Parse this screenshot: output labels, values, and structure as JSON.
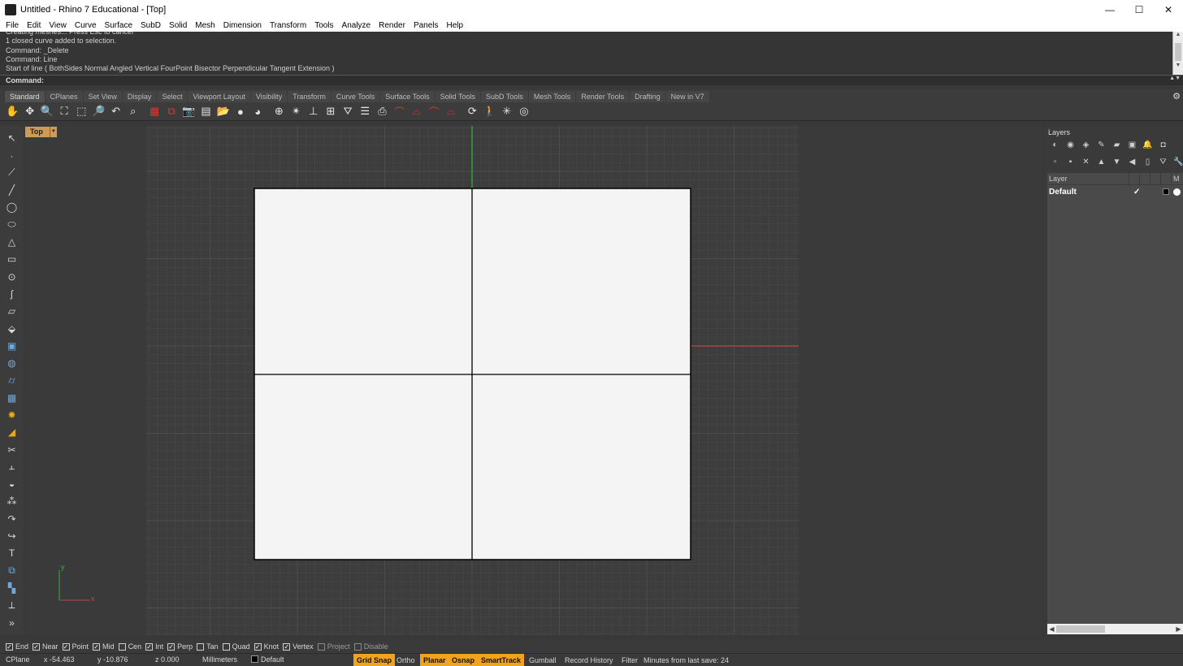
{
  "window": {
    "title": "Untitled - Rhino 7 Educational - [Top]",
    "controls": {
      "minimize": "—",
      "maximize": "☐",
      "close": "✕"
    }
  },
  "menu": [
    "File",
    "Edit",
    "View",
    "Curve",
    "Surface",
    "SubD",
    "Solid",
    "Mesh",
    "Dimension",
    "Transform",
    "Tools",
    "Analyze",
    "Render",
    "Panels",
    "Help"
  ],
  "command_history": [
    "Creating meshes... Press Esc to cancel",
    "1 closed curve added to selection.",
    "Command: _Delete",
    "Command: Line",
    "Start of line ( BothSides  Normal  Angled  Vertical  FourPoint  Bisector  Perpendicular  Tangent  Extension )"
  ],
  "command_line": {
    "label": "Command:",
    "value": ""
  },
  "toolbar_tabs": [
    "Standard",
    "CPlanes",
    "Set View",
    "Display",
    "Select",
    "Viewport Layout",
    "Visibility",
    "Transform",
    "Curve Tools",
    "Surface Tools",
    "Solid Tools",
    "SubD Tools",
    "Mesh Tools",
    "Render Tools",
    "Drafting",
    "New in V7"
  ],
  "active_tab": "Standard",
  "tool_icons": [
    {
      "name": "pan-icon",
      "glyph": "✋"
    },
    {
      "name": "rotate-view-icon",
      "glyph": "✥"
    },
    {
      "name": "zoom-dynamic-icon",
      "glyph": "🔍"
    },
    {
      "name": "zoom-extents-icon",
      "glyph": "⛶"
    },
    {
      "name": "zoom-window-icon",
      "glyph": "⬚"
    },
    {
      "name": "zoom-selected-icon",
      "glyph": "🔎"
    },
    {
      "name": "undo-view-icon",
      "glyph": "↶"
    },
    {
      "name": "zoom-target-icon",
      "glyph": "⌕"
    },
    {
      "name": "four-view-icon",
      "glyph": "▦"
    },
    {
      "name": "perspective-icon",
      "glyph": "⧉"
    },
    {
      "name": "camera-icon",
      "glyph": "📷"
    },
    {
      "name": "named-views-icon",
      "glyph": "▤"
    },
    {
      "name": "open-folder-icon",
      "glyph": "📂"
    },
    {
      "name": "sphere-shaded-icon",
      "glyph": "●"
    },
    {
      "name": "render-icon",
      "glyph": "◕"
    },
    {
      "name": "osnap-icon",
      "glyph": "⊕"
    },
    {
      "name": "smart-track-icon",
      "glyph": "✴"
    },
    {
      "name": "gumball-icon",
      "glyph": "⊥"
    },
    {
      "name": "cplane-icon",
      "glyph": "⊞"
    },
    {
      "name": "filter-icon",
      "glyph": "⛛"
    },
    {
      "name": "properties-icon",
      "glyph": "☰"
    },
    {
      "name": "print-icon",
      "glyph": "⎙"
    },
    {
      "name": "car-wire-icon",
      "glyph": "⌒"
    },
    {
      "name": "car-shaded-icon",
      "glyph": "⌓"
    },
    {
      "name": "car-rendered-icon",
      "glyph": "⌒"
    },
    {
      "name": "car-ghost-icon",
      "glyph": "⌓"
    },
    {
      "name": "rotate-3d-icon",
      "glyph": "⟳"
    },
    {
      "name": "walkabout-icon",
      "glyph": "🚶"
    },
    {
      "name": "sun-icon",
      "glyph": "✳"
    },
    {
      "name": "render-settings-icon",
      "glyph": "◎"
    }
  ],
  "left_tools": [
    {
      "name": "select-arrow-icon",
      "glyph": "↖"
    },
    {
      "name": "point-icon",
      "glyph": "·"
    },
    {
      "name": "polyline-icon",
      "glyph": "⟋"
    },
    {
      "name": "line-icon",
      "glyph": "╱"
    },
    {
      "name": "circle-icon",
      "glyph": "◯"
    },
    {
      "name": "ellipse-icon",
      "glyph": "⬭"
    },
    {
      "name": "polygon-icon",
      "glyph": "△"
    },
    {
      "name": "rectangle-icon",
      "glyph": "▭"
    },
    {
      "name": "circle-center-icon",
      "glyph": "⊙"
    },
    {
      "name": "curve-icon",
      "glyph": "∫"
    },
    {
      "name": "surface-corners-icon",
      "glyph": "▱"
    },
    {
      "name": "extrude-icon",
      "glyph": "⬙"
    },
    {
      "name": "box-icon",
      "glyph": "▣"
    },
    {
      "name": "sphere-icon",
      "glyph": "◍"
    },
    {
      "name": "cylinder-icon",
      "glyph": "⌭"
    },
    {
      "name": "mesh-plane-icon",
      "glyph": "▦"
    },
    {
      "name": "explode-icon",
      "glyph": "✹"
    },
    {
      "name": "fillet-edge-icon",
      "glyph": "◢"
    },
    {
      "name": "trim-icon",
      "glyph": "✂"
    },
    {
      "name": "split-icon",
      "glyph": "⫠"
    },
    {
      "name": "boolean-icon",
      "glyph": "◒"
    },
    {
      "name": "array-icon",
      "glyph": "⁂"
    },
    {
      "name": "fillet-icon",
      "glyph": "↷"
    },
    {
      "name": "offset-icon",
      "glyph": "↪"
    },
    {
      "name": "text-icon",
      "glyph": "T"
    },
    {
      "name": "group-icon",
      "glyph": "⧉"
    },
    {
      "name": "block-icon",
      "glyph": "▚"
    },
    {
      "name": "dimension-icon",
      "glyph": "⟂"
    },
    {
      "name": "more-tools-icon",
      "glyph": "»"
    }
  ],
  "viewport": {
    "name": "Top",
    "axis_x": "x",
    "axis_y": "y"
  },
  "layers_panel": {
    "title": "Layers",
    "column_header": "Layer",
    "column_m": "M",
    "rows": [
      {
        "name": "Default",
        "current": "✓"
      }
    ],
    "icons_row1": [
      {
        "name": "color-wheel-icon",
        "glyph": "◐"
      },
      {
        "name": "materials-icon",
        "glyph": "◉"
      },
      {
        "name": "layers-tab-icon",
        "glyph": "◈"
      },
      {
        "name": "paint-icon",
        "glyph": "✎"
      },
      {
        "name": "folder-icon",
        "glyph": "▰"
      },
      {
        "name": "display-icon",
        "glyph": "▣"
      },
      {
        "name": "notification-icon",
        "glyph": "🔔"
      },
      {
        "name": "camera-tab-icon",
        "glyph": "◘"
      }
    ],
    "icons_row2": [
      {
        "name": "new-layer-icon",
        "glyph": "▫"
      },
      {
        "name": "new-sublayer-icon",
        "glyph": "▪"
      },
      {
        "name": "delete-layer-icon",
        "glyph": "✕"
      },
      {
        "name": "move-up-icon",
        "glyph": "▲"
      },
      {
        "name": "move-down-icon",
        "glyph": "▼"
      },
      {
        "name": "move-left-icon",
        "glyph": "◀"
      },
      {
        "name": "page-icon",
        "glyph": "▯"
      },
      {
        "name": "filter-layers-icon",
        "glyph": "⛛"
      },
      {
        "name": "layer-options-icon",
        "glyph": "🔧"
      }
    ]
  },
  "osnaps": [
    {
      "label": "End",
      "checked": true
    },
    {
      "label": "Near",
      "checked": true
    },
    {
      "label": "Point",
      "checked": true
    },
    {
      "label": "Mid",
      "checked": true
    },
    {
      "label": "Cen",
      "checked": false
    },
    {
      "label": "Int",
      "checked": true
    },
    {
      "label": "Perp",
      "checked": true
    },
    {
      "label": "Tan",
      "checked": false
    },
    {
      "label": "Quad",
      "checked": false
    },
    {
      "label": "Knot",
      "checked": true
    },
    {
      "label": "Vertex",
      "checked": true
    },
    {
      "label": "Project",
      "checked": false,
      "dim": true
    },
    {
      "label": "Disable",
      "checked": false,
      "dim": true
    }
  ],
  "status": {
    "cplane": "CPlane",
    "x": "x -54.463",
    "y": "y -10.876",
    "z": "z 0.000",
    "units": "Millimeters",
    "layer": "Default",
    "toggles": [
      {
        "label": "Grid Snap",
        "on": true
      },
      {
        "label": "Ortho",
        "on": false
      },
      {
        "label": "Planar",
        "on": true
      },
      {
        "label": "Osnap",
        "on": true
      },
      {
        "label": "SmartTrack",
        "on": true
      },
      {
        "label": "Gumball",
        "on": false
      },
      {
        "label": "Record History",
        "on": false
      },
      {
        "label": "Filter",
        "on": false
      }
    ],
    "save_info": "Minutes from last save: 24"
  },
  "colors": {
    "viewport_bg": "#3a3a3a",
    "grid_minor": "#444444",
    "grid_major": "#4d4d4d",
    "surface_fill": "#f4f4f4",
    "x_axis": "#b84a4a",
    "y_axis": "#3cb043",
    "status_on": "#f0a31b",
    "viewport_label": "#cf9a55"
  }
}
